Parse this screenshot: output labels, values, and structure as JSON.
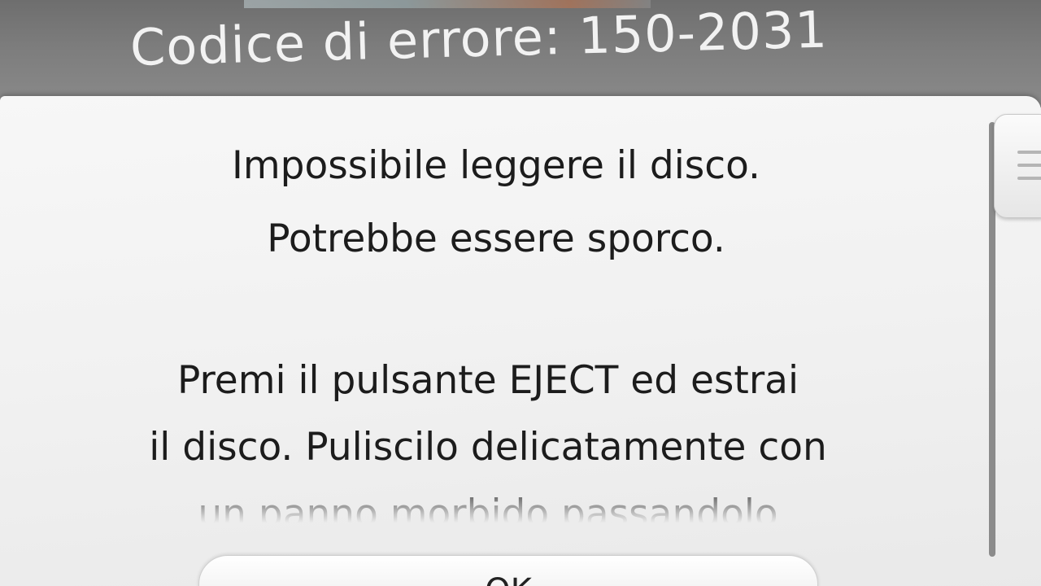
{
  "header": {
    "error_code": "Codice di errore: 150-2031"
  },
  "message": {
    "lines": [
      "Impossibile leggere il disco.",
      "Potrebbe essere sporco.",
      "Premi il pulsante EJECT ed estrai",
      "il disco. Puliscilo delicatamente con",
      "un panno morbido passandolo"
    ]
  },
  "buttons": {
    "ok_label": "OK"
  }
}
